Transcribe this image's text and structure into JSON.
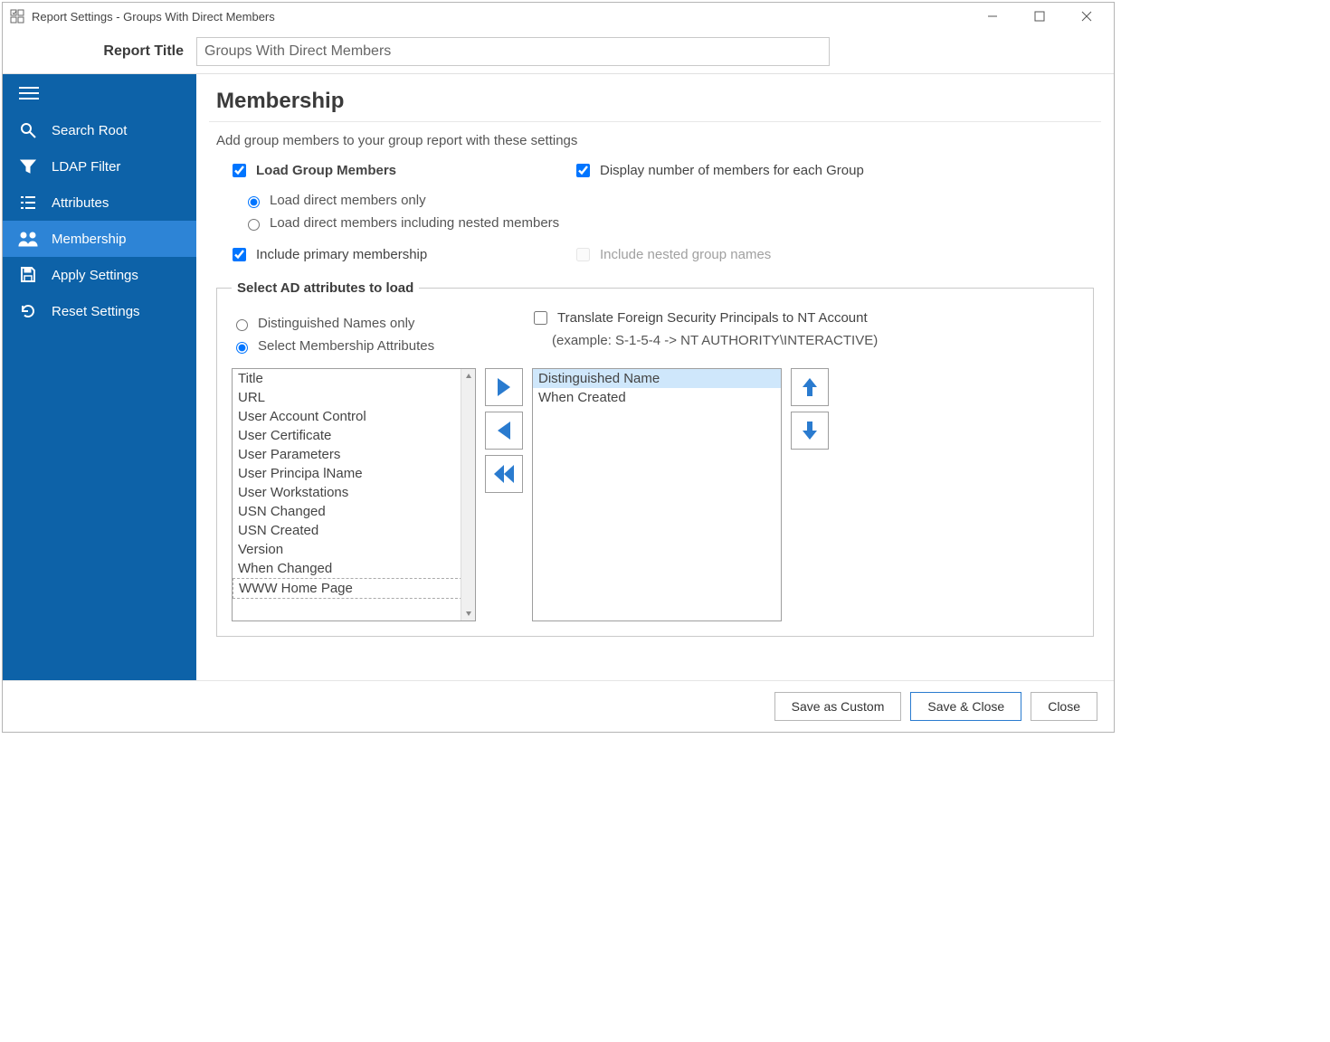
{
  "window": {
    "title": "Report Settings - Groups With Direct Members"
  },
  "header": {
    "report_title_label": "Report Title",
    "report_title_value": "Groups With Direct Members"
  },
  "sidebar": {
    "items": [
      {
        "label": "Search Root"
      },
      {
        "label": "LDAP Filter"
      },
      {
        "label": "Attributes"
      },
      {
        "label": "Membership"
      },
      {
        "label": "Apply Settings"
      },
      {
        "label": "Reset Settings"
      }
    ],
    "selected_index": 3
  },
  "main": {
    "heading": "Membership",
    "intro": "Add group members to your group report with these settings",
    "load_group_members_label": "Load Group Members",
    "display_member_count_label": "Display number of members for each Group",
    "radio_direct_only": "Load direct members only",
    "radio_direct_nested": "Load direct members including nested members",
    "include_primary_label": "Include primary membership",
    "include_nested_names_label": "Include nested group names",
    "fieldset_legend": "Select AD attributes to load",
    "radio_dn_only": "Distinguished Names only",
    "radio_select_attrs": "Select Membership Attributes",
    "translate_fsp_label": "Translate Foreign Security Principals to NT Account",
    "translate_example": "(example: S-1-5-4 -> NT AUTHORITY\\INTERACTIVE)",
    "available_attributes": [
      "Title",
      "URL",
      "User Account Control",
      "User Certificate",
      "User Parameters",
      "User Principa lName",
      "User Workstations",
      "USN Changed",
      "USN Created",
      "Version",
      "When Changed",
      "WWW Home Page"
    ],
    "selected_attributes": [
      "Distinguished Name",
      "When Created"
    ]
  },
  "footer": {
    "save_custom": "Save as Custom",
    "save_close": "Save & Close",
    "close": "Close"
  }
}
